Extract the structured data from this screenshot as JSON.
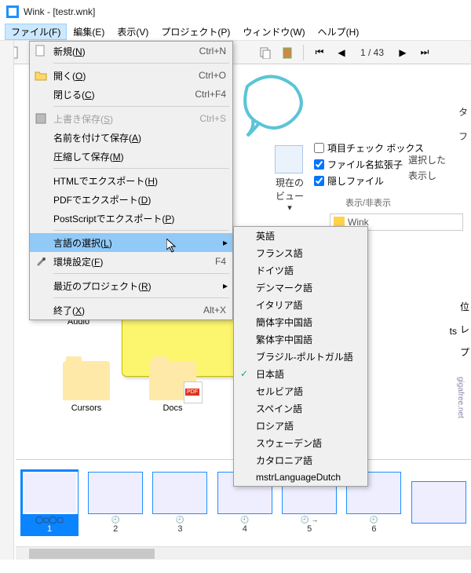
{
  "title": "Wink - [testr.wnk]",
  "menubar": [
    "ファイル(F)",
    "編集(E)",
    "表示(V)",
    "プロジェクト(P)",
    "ウィンドウ(W)",
    "ヘルプ(H)"
  ],
  "toolbar": {
    "page": "1 / 43"
  },
  "file_menu": [
    {
      "label": "新規(N)",
      "shortcut": "Ctrl+N",
      "icon": "new"
    },
    {
      "sep": true
    },
    {
      "label": "開く(O)",
      "shortcut": "Ctrl+O",
      "icon": "open"
    },
    {
      "label": "閉じる(C)",
      "shortcut": "Ctrl+F4"
    },
    {
      "sep": true
    },
    {
      "label": "上書き保存(S)",
      "shortcut": "Ctrl+S",
      "icon": "save",
      "disabled": true
    },
    {
      "label": "名前を付けて保存(A)"
    },
    {
      "label": "圧縮して保存(M)"
    },
    {
      "sep": true
    },
    {
      "label": "HTMLでエクスポート(H)"
    },
    {
      "label": "PDFでエクスポート(D)"
    },
    {
      "label": "PostScriptでエクスポート(P)"
    },
    {
      "sep": true
    },
    {
      "label": "言語の選択(L)",
      "submenu": true,
      "hover": true
    },
    {
      "label": "環境設定(F)",
      "shortcut": "F4",
      "icon": "prefs"
    },
    {
      "sep": true
    },
    {
      "label": "最近のプロジェクト(R)",
      "submenu": true
    },
    {
      "sep": true
    },
    {
      "label": "終了(X)",
      "shortcut": "Alt+X"
    }
  ],
  "languages": [
    "英語",
    "フランス語",
    "ドイツ語",
    "デンマーク語",
    "イタリア語",
    "簡体字中国語",
    "繁体字中国語",
    "ブラジル-ポルトガル語",
    "日本語",
    "セルビア語",
    "スペイン語",
    "ロシア語",
    "スウェーデン語",
    "カタロニア語",
    "mstrLanguageDutch"
  ],
  "lang_selected": "日本語",
  "ribbon": {
    "nav_label": "現在のビュー",
    "checks": [
      {
        "label": "項目チェック ボックス",
        "checked": false
      },
      {
        "label": "ファイル名拡張子",
        "checked": true
      },
      {
        "label": "隠しファイル",
        "checked": true
      }
    ],
    "side_opt1": "選択した",
    "side_opt2": "表示し",
    "section": "表示/非表示"
  },
  "url_text": "Wink",
  "folders": [
    {
      "label": "Audio"
    },
    {
      "label": "Cursors"
    },
    {
      "label": "Docs",
      "pdf": true
    }
  ],
  "thumbs": [
    1,
    2,
    3,
    4,
    5,
    6
  ],
  "side_right": [
    "タ",
    "フ",
    "位",
    "レ",
    "プ"
  ],
  "watermark": "gigafree.net",
  "shortcuts_label": "ts"
}
